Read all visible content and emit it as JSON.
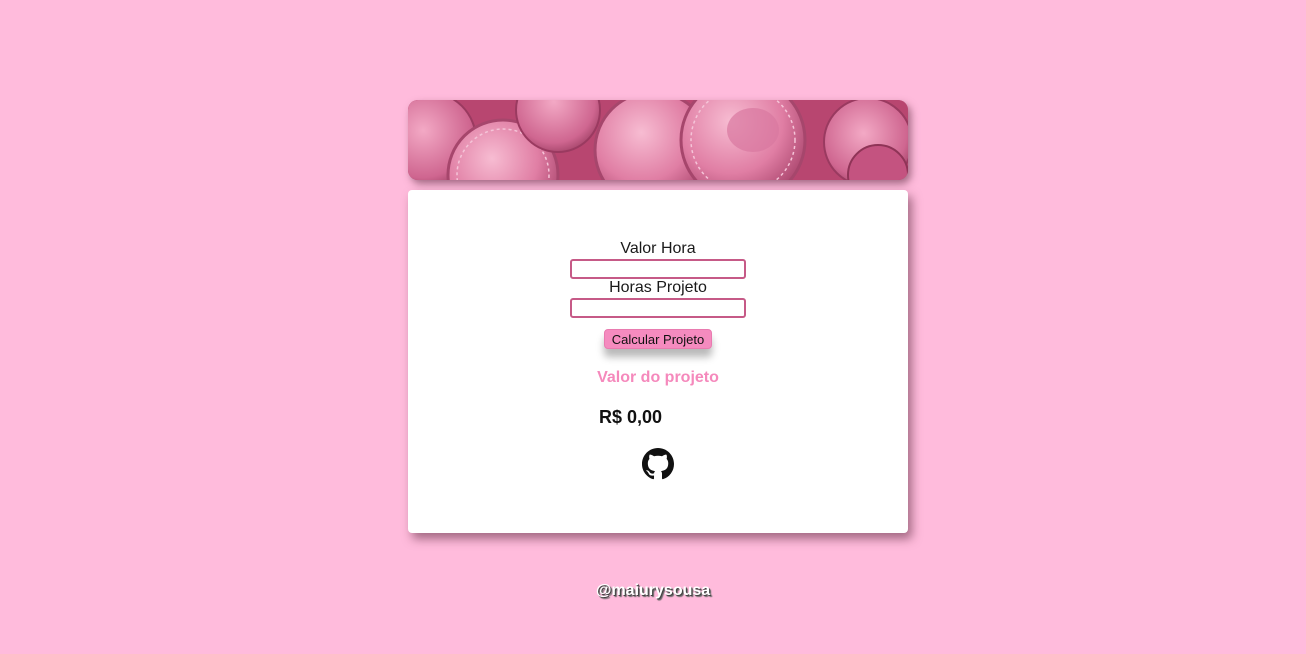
{
  "form": {
    "hourly_rate_label": "Valor Hora",
    "hourly_rate_value": "",
    "project_hours_label": "Horas Projeto",
    "project_hours_value": "",
    "calculate_button": "Calcular Projeto"
  },
  "result": {
    "title": "Valor do projeto",
    "value": "R$ 0,00"
  },
  "links": {
    "github_icon": "github-icon"
  },
  "footer": {
    "handle": "@maiurysousa"
  },
  "colors": {
    "background": "#ffbbdc",
    "accent": "#f589bc",
    "input_border": "#c65a87",
    "banner": "#c9577f"
  }
}
